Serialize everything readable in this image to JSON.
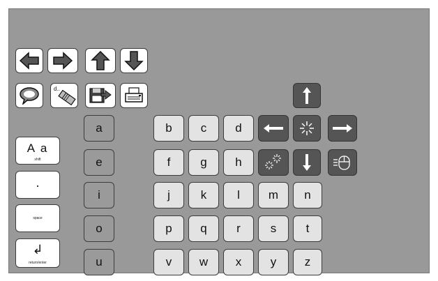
{
  "icons": {
    "left_arrow": "arrow-left-icon",
    "right_arrow": "arrow-right-icon",
    "up_arrow": "arrow-up-icon",
    "down_arrow": "arrow-down-icon",
    "speak": "speech-bubble-icon",
    "clear": "eraser-icon",
    "save": "floppy-disk-icon",
    "print": "printer-icon",
    "mouse_up": "mouse-up-icon",
    "mouse_left": "mouse-left-icon",
    "mouse_click": "mouse-click-icon",
    "mouse_right": "mouse-right-icon",
    "mouse_double_click": "mouse-double-click-icon",
    "mouse_down": "mouse-down-icon",
    "mouse_drag": "mouse-drag-icon"
  },
  "clear_key": {
    "label": "d.."
  },
  "vowel_column": [
    "a",
    "e",
    "i",
    "o",
    "u"
  ],
  "letter_rows": [
    [
      "b",
      "c",
      "d"
    ],
    [
      "f",
      "g",
      "h"
    ],
    [
      "j",
      "k",
      "l",
      "m",
      "n"
    ],
    [
      "p",
      "q",
      "r",
      "s",
      "t"
    ],
    [
      "v",
      "w",
      "x",
      "y",
      "z"
    ]
  ],
  "side_keys": {
    "shift": {
      "glyph": "A a",
      "label": "shift"
    },
    "period": {
      "glyph": "."
    },
    "space": {
      "label": "space"
    },
    "return": {
      "glyph": "↲",
      "label": "return/enter"
    }
  },
  "colors": {
    "background": "#999999",
    "consonant_key": "#e3e3e3",
    "vowel_key": "#9a9a9a",
    "mouse_key": "#555555",
    "border": "#3c3c3c"
  }
}
